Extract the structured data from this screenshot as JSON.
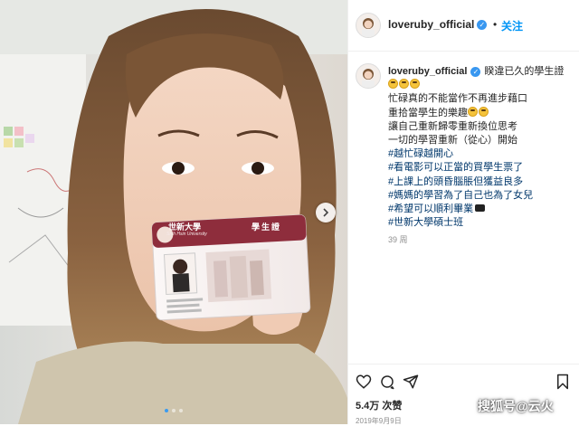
{
  "post": {
    "username": "loveruby_official",
    "header_separator": "•",
    "follow_label": "关注",
    "caption_lead": "睽違已久的學生證",
    "caption_lines": [
      "忙碌真的不能當作不再進步藉口",
      "重拾當學生的樂趣",
      "讓自己重新歸零重新換位思考",
      "一切的學習重新（從心）開始"
    ],
    "hashtags": [
      "#越忙碌越開心",
      "#看電影可以正當的買學生票了",
      "#上課上的頭昏腦脹但獲益良多",
      "#媽媽的學習為了自己也為了女兒",
      "#希望可以順利畢業",
      "#世新大學碩士班"
    ],
    "time_ago": "39 周",
    "likes": "5.4万 次赞",
    "date": "2019年9月9日"
  },
  "student_card": {
    "school_name": "世新大學",
    "school_name_en": "Shih Hsin University",
    "card_title": "學生證"
  },
  "watermark": "搜狐号@云火",
  "colors": {
    "link": "#00376b",
    "follow": "#0095f6",
    "verified": "#3897f0"
  },
  "icons": [
    "heart-icon",
    "comment-icon",
    "share-icon",
    "bookmark-icon",
    "verified-icon",
    "chevron-right-icon"
  ]
}
